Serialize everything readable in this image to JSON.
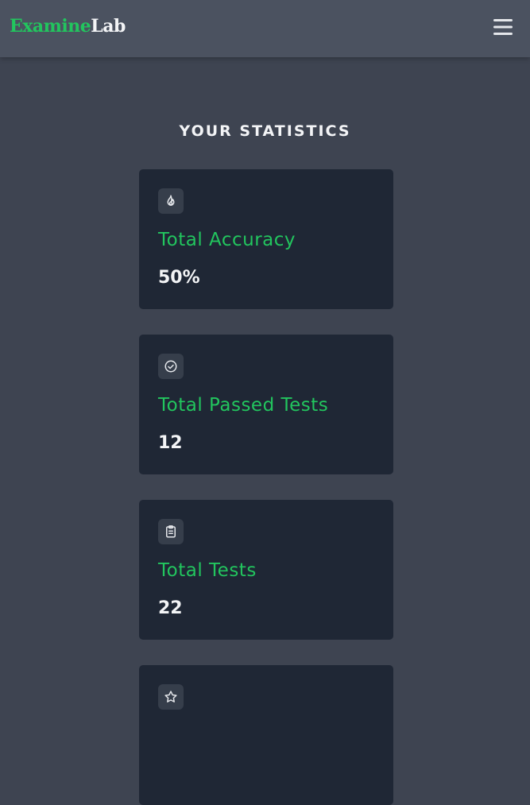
{
  "brand": {
    "part1": "Examine",
    "part2": "Lab"
  },
  "header": {
    "menu_icon": "hamburger-menu-icon"
  },
  "page": {
    "title": "YOUR STATISTICS"
  },
  "stats": [
    {
      "icon": "flame-icon",
      "label": "Total Accuracy",
      "value": "50%"
    },
    {
      "icon": "check-circle-icon",
      "label": "Total Passed Tests",
      "value": "12"
    },
    {
      "icon": "clipboard-icon",
      "label": "Total Tests",
      "value": "22"
    },
    {
      "icon": "star-icon"
    }
  ],
  "colors": {
    "accent": "#22c55e",
    "background": "#3e4451",
    "navbar": "#4b5260",
    "card": "#1f2735",
    "text": "#f3f4f6"
  }
}
